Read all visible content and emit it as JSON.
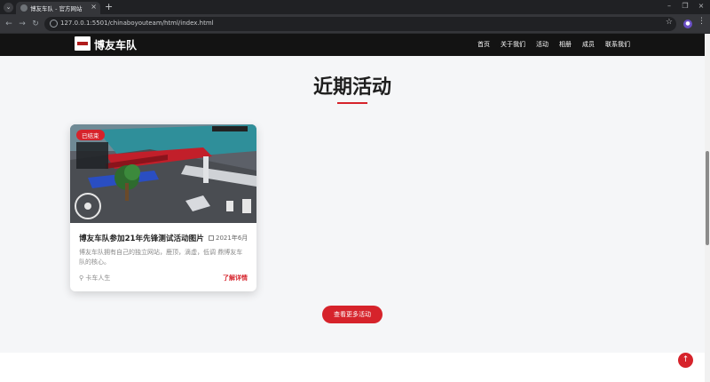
{
  "browser": {
    "tab_title": "博友车队 - 官方网站",
    "new_tab": "+",
    "url": "127.0.0.1:5501/chinaboyouteam/html/index.html"
  },
  "site": {
    "brand": "博友车队",
    "nav": [
      "首页",
      "关于我们",
      "活动",
      "相册",
      "成员",
      "联系我们"
    ]
  },
  "section": {
    "title": "近期活动",
    "more_button": "查看更多活动"
  },
  "card": {
    "badge": "已结束",
    "title": "博友车队参加21年先锋测试活动图片",
    "date": "2021年6月",
    "description": "博友车队拥有自己的独立网站，鹿顶，滴虚，低调 鼎博友车队的核心。",
    "location": "卡车人生",
    "link": "了解详情"
  },
  "colors": {
    "accent": "#d6232b",
    "header_bg": "#131313",
    "page_bg": "#f5f6f8"
  },
  "icons": {
    "back_to_top": "arrow-up-icon",
    "calendar": "calendar-icon",
    "location": "map-pin-icon"
  }
}
